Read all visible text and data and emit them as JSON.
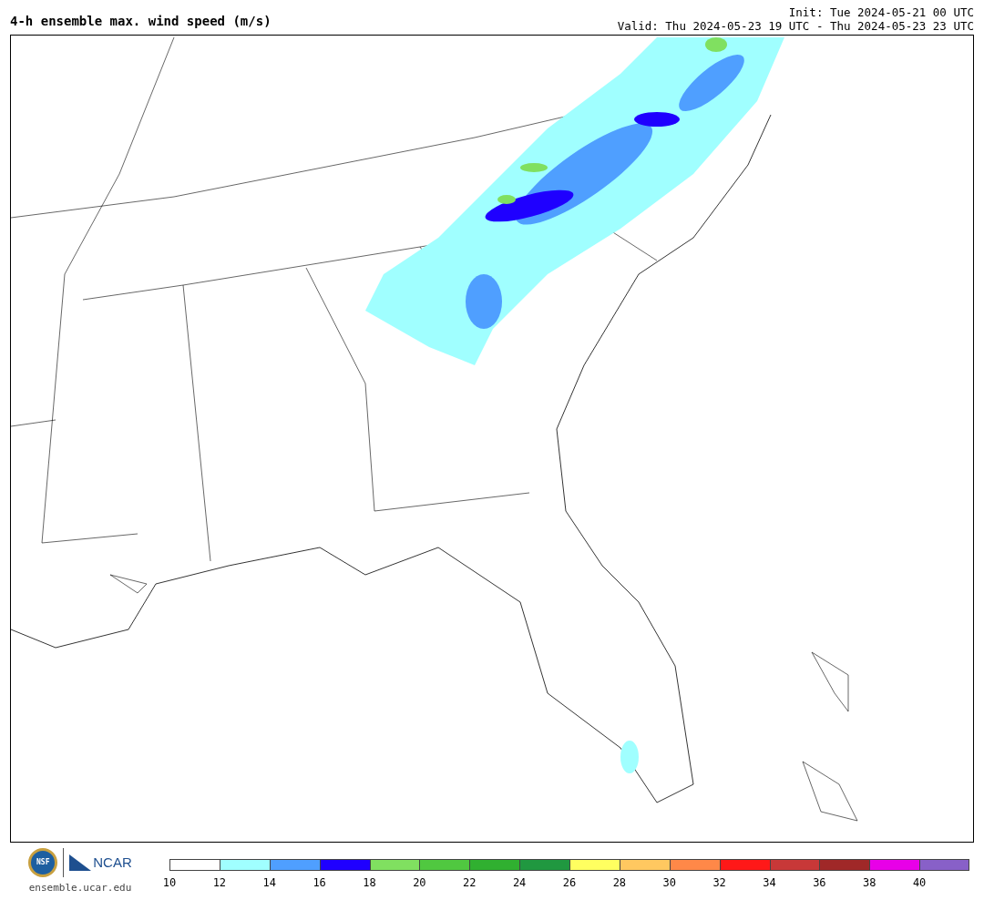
{
  "title": "4-h ensemble max. wind speed (m/s)",
  "init": "Init: Tue 2024-05-21 00 UTC",
  "valid": "Valid: Thu 2024-05-23 19 UTC - Thu 2024-05-23 23 UTC",
  "logos": [
    "NSF",
    "NCAR"
  ],
  "url": "ensemble.ucar.edu",
  "colorbar": {
    "bins": [
      {
        "label": "10",
        "color": "#ffffff"
      },
      {
        "label": "12",
        "color": "#a0ffff"
      },
      {
        "label": "14",
        "color": "#4f9fff"
      },
      {
        "label": "16",
        "color": "#1f00ff"
      },
      {
        "label": "18",
        "color": "#80e060"
      },
      {
        "label": "20",
        "color": "#50c840"
      },
      {
        "label": "22",
        "color": "#30b030"
      },
      {
        "label": "24",
        "color": "#209840"
      },
      {
        "label": "26",
        "color": "#ffff60"
      },
      {
        "label": "28",
        "color": "#ffc860"
      },
      {
        "label": "30",
        "color": "#ff8848"
      },
      {
        "label": "32",
        "color": "#ff1818"
      },
      {
        "label": "34",
        "color": "#c83838"
      },
      {
        "label": "36",
        "color": "#a02828"
      },
      {
        "label": "38",
        "color": "#e800e8"
      },
      {
        "label": "40",
        "color": "#8860c8"
      }
    ]
  }
}
